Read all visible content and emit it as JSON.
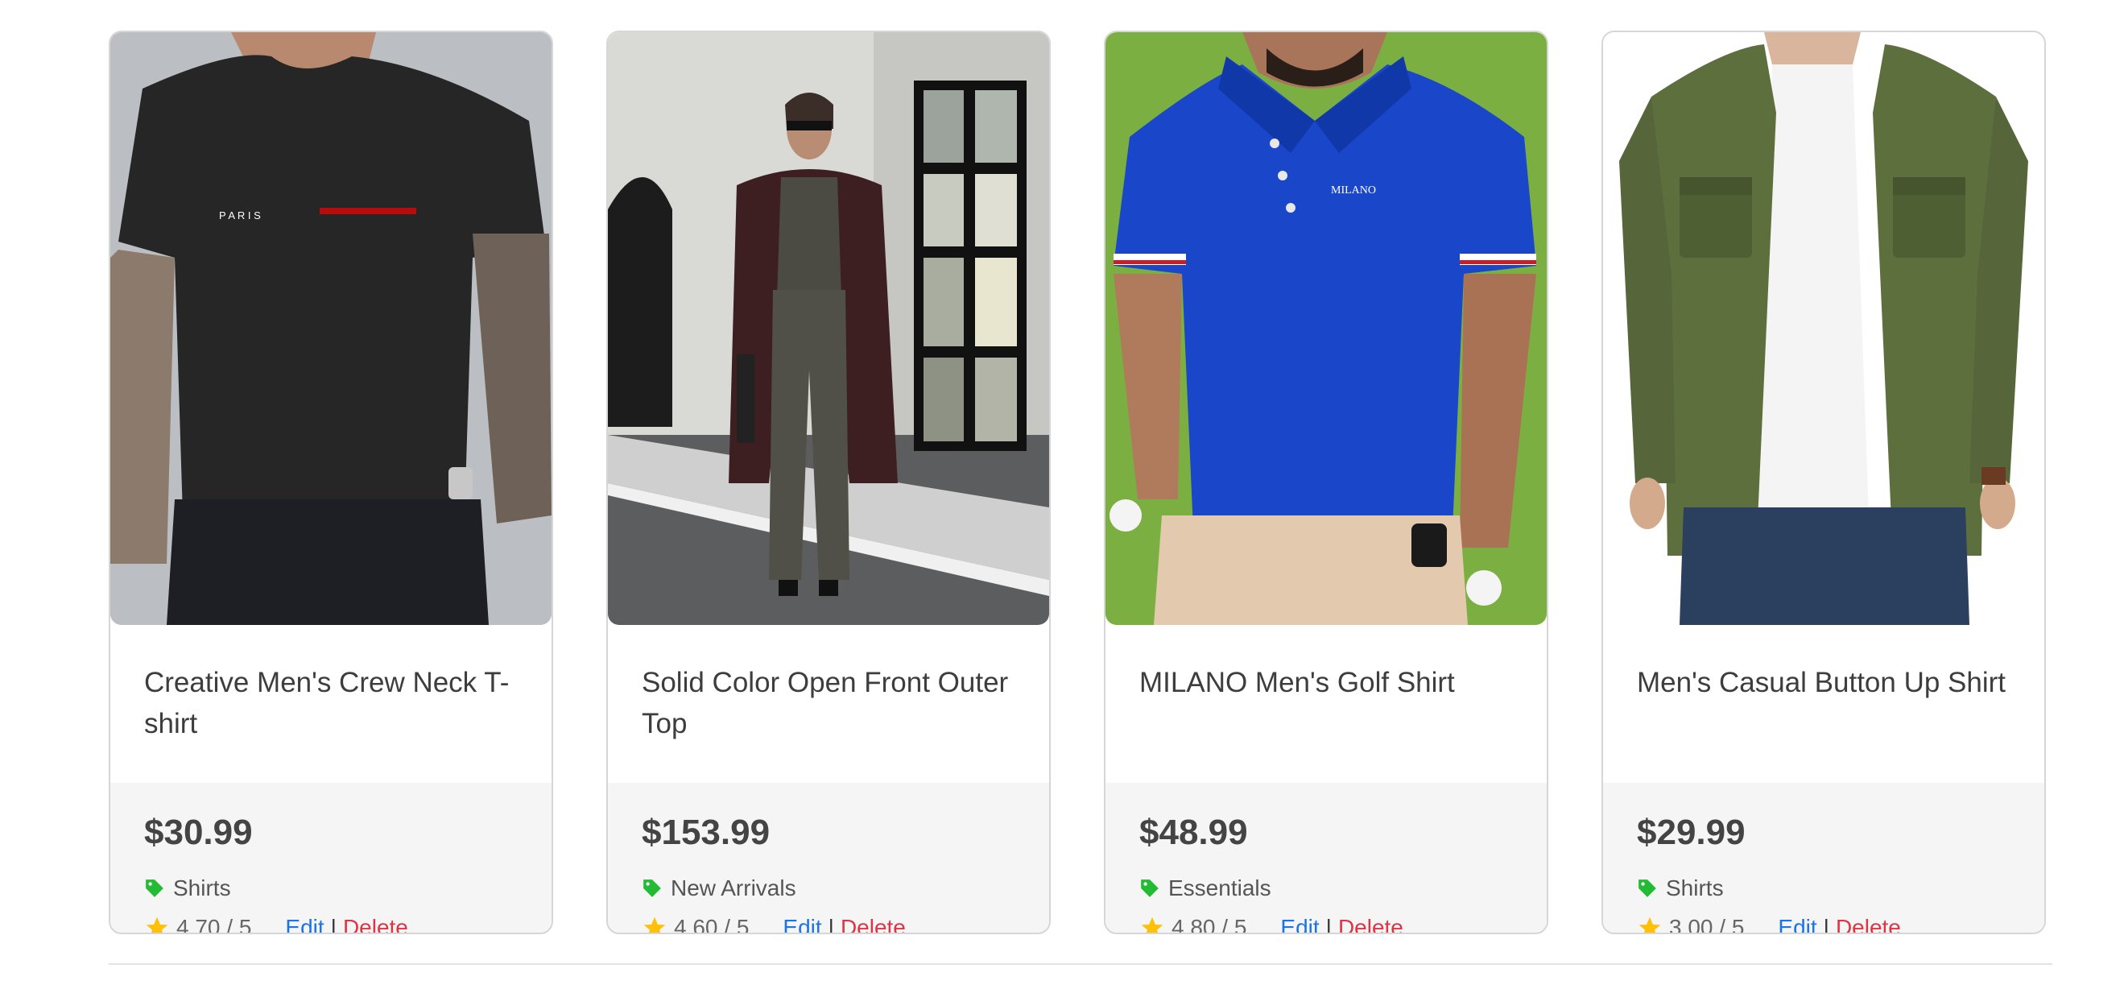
{
  "products": [
    {
      "title": "Creative Men's Crew Neck T-shirt",
      "price": "$30.99",
      "category": "Shirts",
      "rating": "4.70 / 5",
      "edit_label": "Edit",
      "separator": "|",
      "delete_label": "Delete",
      "image_icon": "black-tshirt-photo"
    },
    {
      "title": "Solid Color Open Front Outer Top",
      "price": "$153.99",
      "category": "New Arrivals",
      "rating": "4.60 / 5",
      "edit_label": "Edit",
      "separator": "|",
      "delete_label": "Delete",
      "image_icon": "woman-coat-photo"
    },
    {
      "title": "MILANO Men's Golf Shirt",
      "price": "$48.99",
      "category": "Essentials",
      "rating": "4.80 / 5",
      "edit_label": "Edit",
      "separator": "|",
      "delete_label": "Delete",
      "image_icon": "blue-polo-photo"
    },
    {
      "title": "Men's Casual Button Up Shirt",
      "price": "$29.99",
      "category": "Shirts",
      "rating": "3.00 / 5",
      "edit_label": "Edit",
      "separator": "|",
      "delete_label": "Delete",
      "image_icon": "green-shirt-photo"
    }
  ],
  "image_text": {
    "tshirt_print": "P A R I S",
    "polo_logo": "MILANO"
  },
  "colors": {
    "edit_link": "#1a73e8",
    "delete_link": "#dc3545",
    "tag_icon": "#22bb33",
    "star_icon": "#ffc107"
  }
}
